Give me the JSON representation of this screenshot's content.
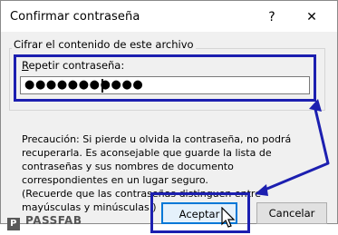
{
  "window": {
    "title": "Confirmar contraseña",
    "help_glyph": "?",
    "close_glyph": "✕"
  },
  "group": {
    "label": "Cifrar el contenido de este archivo"
  },
  "field": {
    "label_mnemonic": "R",
    "label_rest": "epetir contraseña:",
    "value_masked": "●●●●●●●●●●●"
  },
  "warning": {
    "line1": "Precaución: Si pierde u olvida la contraseña, no podrá recuperarla. Es aconsejable que guarde la lista de contraseñas y sus nombres de documento correspondientes en un lugar seguro.",
    "line2": "(Recuerde que las contraseñas distinguen entre mayúsculas y minúsculas.)"
  },
  "buttons": {
    "ok": "Aceptar",
    "cancel": "Cancelar"
  },
  "watermark": {
    "logo_text": "P",
    "text": "PASSFAB"
  },
  "colors": {
    "highlight": "#1c1fb0",
    "default_button_border": "#0078d7"
  },
  "icons": {
    "cursor": "arrow-pointer-icon",
    "annotation": "annotation-arrow"
  }
}
